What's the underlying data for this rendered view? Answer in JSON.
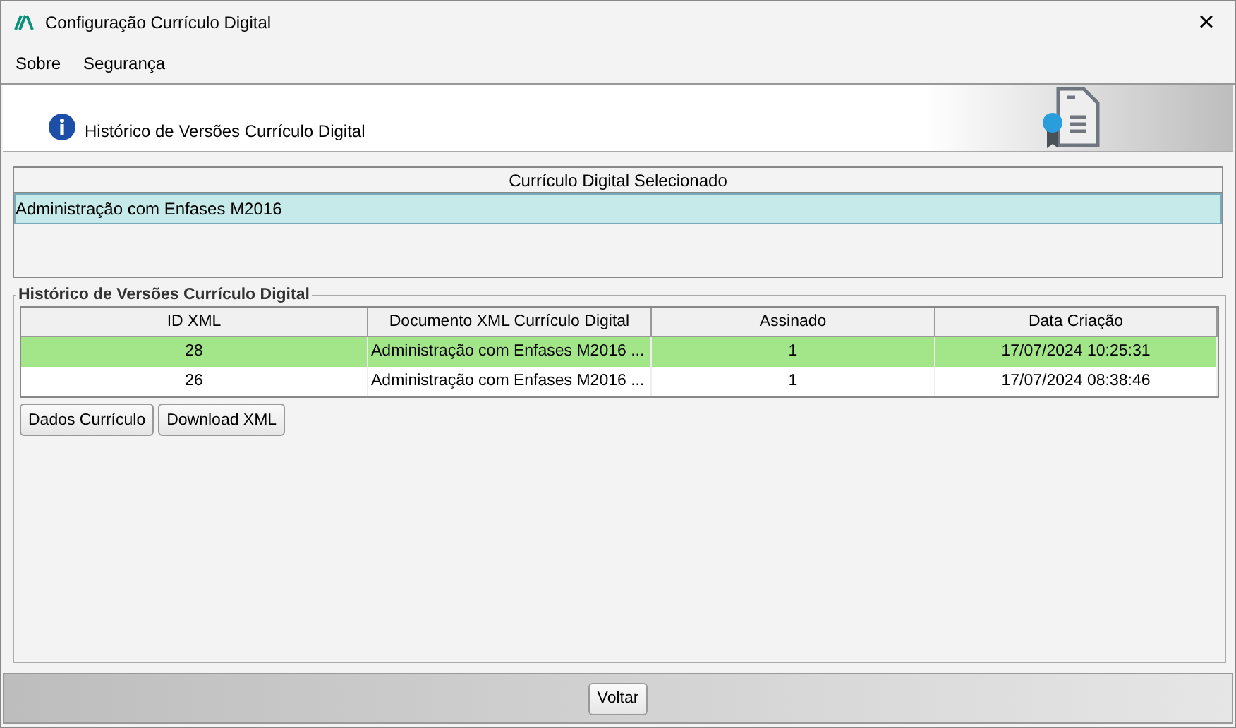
{
  "window": {
    "title": "Configuração Currículo Digital",
    "close": "×"
  },
  "menu": [
    {
      "label": "Sobre"
    },
    {
      "label": "Segurança"
    }
  ],
  "header": {
    "title": "Histórico de Versões Currículo Digital"
  },
  "selected_panel": {
    "heading": "Currículo Digital Selecionado",
    "value": "Administração com Enfases M2016"
  },
  "history": {
    "legend": "Histórico de Versões Currículo Digital",
    "columns": [
      "ID XML",
      "Documento XML Currículo Digital",
      "Assinado",
      "Data Criação"
    ],
    "rows": [
      {
        "cells": [
          "28",
          "Administração com Enfases M2016 ...",
          "1",
          "17/07/2024 10:25:31"
        ],
        "selected": true
      },
      {
        "cells": [
          "26",
          "Administração com Enfases M2016 ...",
          "1",
          "17/07/2024 08:38:46"
        ],
        "selected": false
      }
    ],
    "buttons": [
      "Dados Currículo",
      "Download XML"
    ]
  },
  "footer": {
    "buttons": [
      "Voltar"
    ]
  }
}
